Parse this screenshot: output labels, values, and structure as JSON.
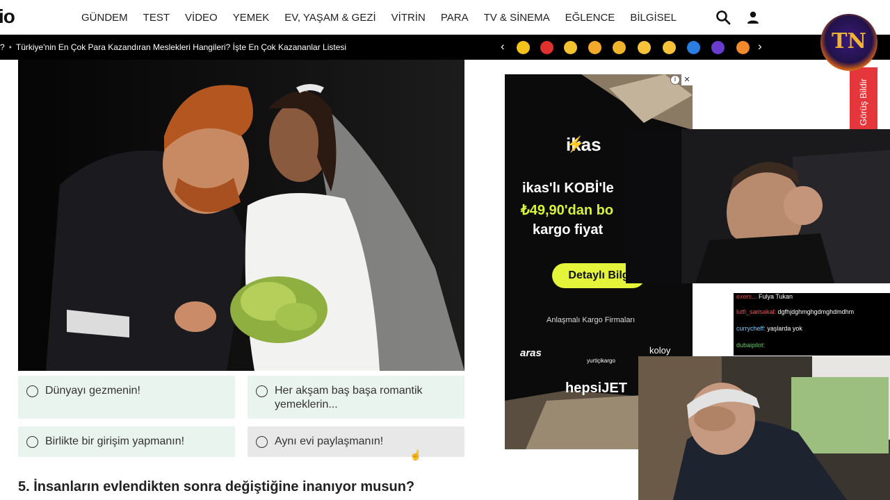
{
  "nav": {
    "logo": "io",
    "items": [
      "GÜNDEM",
      "TEST",
      "VİDEO",
      "YEMEK",
      "EV, YAŞAM & GEZİ",
      "VİTRİN",
      "PARA",
      "TV & SİNEMA",
      "EĞLENCE",
      "BİLGİSEL"
    ],
    "search_icon": "search-icon",
    "user_icon": "user-icon"
  },
  "newsbar": {
    "prefix": "?",
    "headline": "Türkiye'nin En Çok Para Kazandıran Meslekleri Hangileri? İşte En Çok Kazananlar Listesi"
  },
  "emojibar": {
    "prev": "‹",
    "next": "›",
    "colors": [
      "#f4c21a",
      "#e0312f",
      "#f2c230",
      "#f4a92a",
      "#f2b32c",
      "#f5c23a",
      "#f5c23a",
      "#2a7de1",
      "#6a3bd1",
      "#f08a2a"
    ]
  },
  "quiz": {
    "options": [
      {
        "label": "Dünyayı gezmenin!"
      },
      {
        "label": "Her akşam baş başa romantik yemeklerin..."
      },
      {
        "label": "Birlikte bir girişim yapmanın!"
      },
      {
        "label": "Aynı evi paylaşmanın!"
      }
    ],
    "next_question": "5. İnsanların evlendikten sonra değiştiğine inanıyor musun?"
  },
  "ad": {
    "brand": "ikas",
    "line1": "ikas'lı KOBİ'le",
    "line2": "₺49,90'dan bo",
    "line3": "kargo fiyat",
    "cta": "Detaylı Bilg",
    "partners_title": "Anlaşmalı Kargo Firmaları",
    "partner1": "aras",
    "partner2": "yurtiçikargo",
    "partner3": "koloy",
    "partner4": "hepsiJET",
    "info_icon": "info-icon",
    "close": "✕"
  },
  "stream": {
    "feedback": "Görüş Bildir",
    "logo_text": "TN",
    "chat": [
      {
        "user": "exers...",
        "msg": "Fulya   Tukan"
      },
      {
        "user": "lutfi_sarisakal:",
        "msg": "dgfhjdghmghgdmghdmdhm"
      },
      {
        "user": "currycheff:",
        "msg": "yaşlarda yok"
      },
      {
        "user": "dubaipilot:",
        "msg": ""
      }
    ]
  }
}
